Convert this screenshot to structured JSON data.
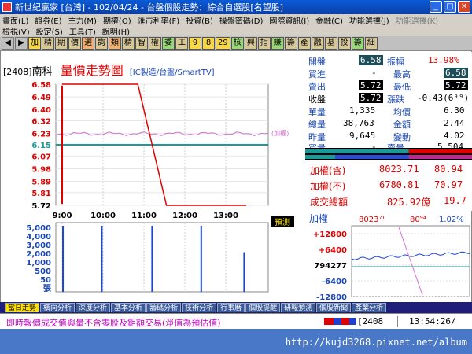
{
  "window": {
    "title": "新世紀贏家 [台灣] - 102/04/24 - 台盤個股走勢：綜合自選股[名望股]"
  },
  "menu1": [
    "畫面(L)",
    "證券(E)",
    "主力(M)",
    "期權(O)",
    "匯市利率(F)",
    "投資(B)",
    "操盤密碼(D)",
    "國際資訊(I)",
    "金融(C)",
    "功能選擇(J)",
    "功能選擇(K)"
  ],
  "menu2": [
    "檢視(V)",
    "設定(S)",
    "工具(T)",
    "說明(H)"
  ],
  "toolbar": [
    "加",
    "精",
    "期",
    "價",
    "選",
    "詢",
    "類",
    "精",
    "智",
    "權",
    "委",
    "工",
    "9",
    "8",
    "29",
    "核",
    "興",
    "指",
    "賺",
    "籌",
    "產",
    "融",
    "基",
    "投",
    "籌",
    "細"
  ],
  "stock": {
    "code": "[2408]",
    "name": "南科",
    "chart_title": "量價走勢圖",
    "subtitle": "[IC製造/台盤/SmartTV]",
    "pre_label": "(加權)",
    "forecast_label": "預測"
  },
  "quote": {
    "open": {
      "label": "開盤",
      "value": "6.58"
    },
    "amplitude": {
      "label": "振幅",
      "value": "13.98%"
    },
    "buy": {
      "label": "買進",
      "value": "-"
    },
    "high": {
      "label": "最高",
      "value": "6.58"
    },
    "sell": {
      "label": "賣出",
      "value": "5.72"
    },
    "low": {
      "label": "最低",
      "value": "5.72"
    },
    "close": {
      "label": "收盤",
      "value": "5.72"
    },
    "change": {
      "label": "漲跌",
      "value": "-0.43(6⁹⁹)"
    },
    "unit_vol": {
      "label": "單量",
      "value": "1,335"
    },
    "avg": {
      "label": "均價",
      "value": "6.30"
    },
    "total_vol": {
      "label": "總量",
      "value": "38,763"
    },
    "amount": {
      "label": "金額",
      "value": "2.44"
    },
    "yest_vol": {
      "label": "昨量",
      "value": "9,645"
    },
    "chg_vol": {
      "label": "變動",
      "value": "4.02"
    },
    "buy_vol": {
      "label": "買量",
      "value": "-"
    },
    "sell_vol": {
      "label": "賣量",
      "value": "5,504"
    }
  },
  "index": {
    "with": {
      "label": "加權(含)",
      "value": "8023.71",
      "chg": "80.94"
    },
    "without": {
      "label": "加權(不)",
      "value": "6780.81",
      "chg": "70.97"
    },
    "turnover": {
      "label": "成交總額",
      "value": "825.92億",
      "chg": "19.7"
    }
  },
  "mini": {
    "title": "加權",
    "value": "8023⁷¹",
    "chg": "80⁹⁴",
    "pct": "1.02%",
    "ticks": [
      "+12800",
      "+6400",
      "794277",
      "-6400",
      "-12800"
    ]
  },
  "chart_data": [
    {
      "type": "line",
      "x": [
        "9:00",
        "10:00",
        "11:00",
        "12:00",
        "13:00"
      ],
      "y_ticks": [
        "6.58",
        "6.49",
        "6.40",
        "6.32",
        "6.23",
        "6.15",
        "6.07",
        "5.98",
        "5.89",
        "5.81",
        "5.72"
      ],
      "ylim": [
        5.72,
        6.58
      ],
      "reference": 6.15,
      "series": [
        {
          "points": [
            [
              0,
              6.58
            ],
            [
              0.06,
              6.58
            ],
            [
              1.85,
              6.58
            ],
            [
              2.55,
              5.72
            ],
            [
              4.5,
              5.72
            ]
          ]
        }
      ]
    },
    {
      "type": "bar",
      "y_ticks": [
        "5,000",
        "4,000",
        "3,000",
        "2,000",
        "1,000",
        "500",
        "50",
        "張"
      ],
      "bars": [
        [
          0.02,
          5000
        ],
        [
          0.97,
          5000
        ],
        [
          2.2,
          5000
        ],
        [
          3.4,
          5000
        ],
        [
          4.45,
          3000
        ]
      ]
    }
  ],
  "tabs": [
    "當日走勢",
    "橫向分析",
    "深度分析",
    "基本分析",
    "籌碼分析",
    "技術分析",
    "行事曆",
    "個股提醒",
    "研報預測",
    "個股新聞",
    "產業分析"
  ],
  "status": {
    "note": "即時報價成交值與量不含零股及鉅額交易(淨值為預估值)",
    "code": "[2408",
    "time": "13:54:26/"
  },
  "taskbar": {
    "url": "http://kujd3268.pixnet.net/album"
  },
  "colors": {
    "accent": "#1846b8",
    "up": "#e00000",
    "down": "#00a000"
  }
}
